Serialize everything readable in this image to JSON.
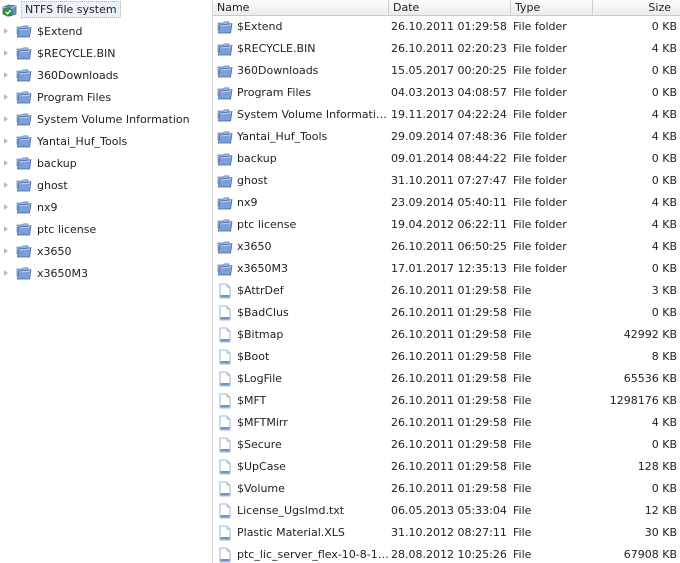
{
  "tree": {
    "root": "NTFS file system",
    "items": [
      "$Extend",
      "$RECYCLE.BIN",
      "360Downloads",
      "Program Files",
      "System Volume Information",
      "Yantai_Huf_Tools",
      "backup",
      "ghost",
      "nx9",
      "ptc license",
      "x3650",
      "x3650M3"
    ]
  },
  "list": {
    "columns": {
      "name": "Name",
      "date": "Date",
      "type": "Type",
      "size": "Size"
    },
    "rows": [
      {
        "name": "$Extend",
        "date": "26.10.2011 01:29:58",
        "type": "File folder",
        "size": "0 KB",
        "kind": "folder"
      },
      {
        "name": "$RECYCLE.BIN",
        "date": "26.10.2011 02:20:23",
        "type": "File folder",
        "size": "4 KB",
        "kind": "folder"
      },
      {
        "name": "360Downloads",
        "date": "15.05.2017 00:20:25",
        "type": "File folder",
        "size": "0 KB",
        "kind": "folder"
      },
      {
        "name": "Program Files",
        "date": "04.03.2013 04:08:57",
        "type": "File folder",
        "size": "0 KB",
        "kind": "folder"
      },
      {
        "name": "System Volume Information",
        "date": "19.11.2017 04:22:24",
        "type": "File folder",
        "size": "4 KB",
        "kind": "folder"
      },
      {
        "name": "Yantai_Huf_Tools",
        "date": "29.09.2014 07:48:36",
        "type": "File folder",
        "size": "4 KB",
        "kind": "folder"
      },
      {
        "name": "backup",
        "date": "09.01.2014 08:44:22",
        "type": "File folder",
        "size": "0 KB",
        "kind": "folder"
      },
      {
        "name": "ghost",
        "date": "31.10.2011 07:27:47",
        "type": "File folder",
        "size": "0 KB",
        "kind": "folder"
      },
      {
        "name": "nx9",
        "date": "23.09.2014 05:40:11",
        "type": "File folder",
        "size": "4 KB",
        "kind": "folder"
      },
      {
        "name": "ptc license",
        "date": "19.04.2012 06:22:11",
        "type": "File folder",
        "size": "4 KB",
        "kind": "folder"
      },
      {
        "name": "x3650",
        "date": "26.10.2011 06:50:25",
        "type": "File folder",
        "size": "4 KB",
        "kind": "folder"
      },
      {
        "name": "x3650M3",
        "date": "17.01.2017 12:35:13",
        "type": "File folder",
        "size": "0 KB",
        "kind": "folder"
      },
      {
        "name": "$AttrDef",
        "date": "26.10.2011 01:29:58",
        "type": "File",
        "size": "3 KB",
        "kind": "file"
      },
      {
        "name": "$BadClus",
        "date": "26.10.2011 01:29:58",
        "type": "File",
        "size": "0 KB",
        "kind": "file"
      },
      {
        "name": "$Bitmap",
        "date": "26.10.2011 01:29:58",
        "type": "File",
        "size": "42992 KB",
        "kind": "file"
      },
      {
        "name": "$Boot",
        "date": "26.10.2011 01:29:58",
        "type": "File",
        "size": "8 KB",
        "kind": "file"
      },
      {
        "name": "$LogFile",
        "date": "26.10.2011 01:29:58",
        "type": "File",
        "size": "65536 KB",
        "kind": "file"
      },
      {
        "name": "$MFT",
        "date": "26.10.2011 01:29:58",
        "type": "File",
        "size": "1298176 KB",
        "kind": "file"
      },
      {
        "name": "$MFTMirr",
        "date": "26.10.2011 01:29:58",
        "type": "File",
        "size": "4 KB",
        "kind": "file"
      },
      {
        "name": "$Secure",
        "date": "26.10.2011 01:29:58",
        "type": "File",
        "size": "0 KB",
        "kind": "file"
      },
      {
        "name": "$UpCase",
        "date": "26.10.2011 01:29:58",
        "type": "File",
        "size": "128 KB",
        "kind": "file"
      },
      {
        "name": "$Volume",
        "date": "26.10.2011 01:29:58",
        "type": "File",
        "size": "0 KB",
        "kind": "file"
      },
      {
        "name": "License_Ugslmd.txt",
        "date": "06.05.2013 05:33:04",
        "type": "File",
        "size": "12 KB",
        "kind": "file"
      },
      {
        "name": "Plastic Material.XLS",
        "date": "31.10.2012 08:27:11",
        "type": "File",
        "size": "30 KB",
        "kind": "file"
      },
      {
        "name": "ptc_lic_server_flex-10-8-10...",
        "date": "28.08.2012 10:25:26",
        "type": "File",
        "size": "67908 KB",
        "kind": "file"
      }
    ]
  },
  "icons": {
    "root": "drive-check-icon",
    "folder": "folder-icon",
    "file": "file-icon"
  }
}
